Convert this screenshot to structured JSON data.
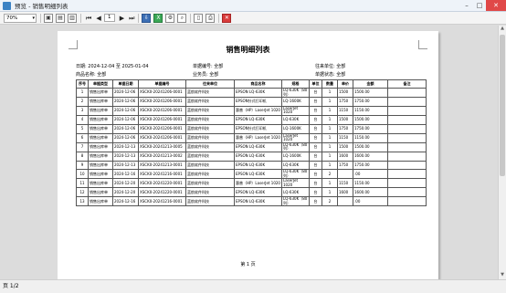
{
  "window": {
    "title": "预览 - 销售明细列表"
  },
  "toolbar": {
    "zoom": "70%",
    "page_input": "1"
  },
  "report": {
    "title": "销售明细列表",
    "date_range": "日期: 2024-12-04 至 2025-01-04",
    "doc_no": "单据编号: 全部",
    "contact": "往来单位: 全部",
    "product": "商品名称: 全部",
    "salesman": "业务员: 全部",
    "doc_status": "单据状态: 全部",
    "columns": [
      "序号",
      "单据类型",
      "单据日期",
      "单据编号",
      "往来单位",
      "商品名称",
      "规格",
      "单位",
      "数量",
      "单价",
      "金额",
      "备注"
    ],
    "rows": [
      [
        "1",
        "销售出库单",
        "2024-12-06",
        "XSCK0-20241206-0001",
        "蓝航软件科技",
        "EPSON LQ-630K",
        "LQ-630K（80列）",
        "台",
        "1",
        "1500",
        "1500.00",
        ""
      ],
      [
        "2",
        "销售出库单",
        "2024-12-06",
        "XSCK0-20241206-0001",
        "蓝航软件科技",
        "EPSON针式打印机",
        "LQ-1600K",
        "台",
        "1",
        "1750",
        "1750.00",
        ""
      ],
      [
        "3",
        "销售出库单",
        "2024-12-06",
        "XSCK0-20241206-0001",
        "蓝航软件科技",
        "惠普（HP）LaserJet 1020",
        "LaserJet 1020",
        "台",
        "1",
        "1150",
        "1150.00",
        ""
      ],
      [
        "4",
        "销售出库单",
        "2024-12-06",
        "XSCK0-20241206-0001",
        "蓝航软件科技",
        "EPSON LQ-630K",
        "LQ-630K",
        "台",
        "1",
        "1500",
        "1500.00",
        ""
      ],
      [
        "5",
        "销售出库单",
        "2024-12-06",
        "XSCK0-20241206-0001",
        "蓝航软件科技",
        "EPSON针式打印机",
        "LQ-1600K",
        "台",
        "1",
        "1750",
        "1750.00",
        ""
      ],
      [
        "6",
        "销售出库单",
        "2024-12-06",
        "XSCK0-20241206-0001",
        "蓝航软件科技",
        "惠普（HP）LaserJet 1020",
        "LaserJet 1020",
        "台",
        "1",
        "1150",
        "1150.00",
        ""
      ],
      [
        "7",
        "销售出库单",
        "2024-12-13",
        "XSCK0-20241213-0005",
        "蓝航软件科技",
        "EPSON LQ-630K",
        "LQ-630K（80列）",
        "台",
        "1",
        "1500",
        "1500.00",
        ""
      ],
      [
        "8",
        "销售出库单",
        "2024-12-13",
        "XSCK0-20241213-0002",
        "蓝航软件科技",
        "EPSON LQ-630K",
        "LQ-1600K",
        "台",
        "1",
        "1600",
        "1600.00",
        ""
      ],
      [
        "9",
        "销售出库单",
        "2024-12-13",
        "XSCK0-20241213-0001",
        "蓝航软件科技",
        "EPSON LQ-630K",
        "LQ-630K",
        "台",
        "1",
        "1750",
        "1750.00",
        ""
      ],
      [
        "10",
        "销售出库单",
        "2024-12-16",
        "XSCK0-20241216-0001",
        "蓝航软件科技",
        "EPSON LQ-630K",
        "LQ-630K（80列）",
        "台",
        "2",
        "",
        ".00",
        ""
      ],
      [
        "11",
        "销售出库单",
        "2024-12-20",
        "XSCK0-20241220-0001",
        "蓝航软件科技",
        "惠普（HP）LaserJet 1020",
        "LaserJet 1020",
        "台",
        "1",
        "1150",
        "1150.00",
        ""
      ],
      [
        "12",
        "销售出库单",
        "2024-12-20",
        "XSCK0-20241220-0001",
        "蓝航软件科技",
        "EPSON LQ-630K",
        "LQ-630K",
        "台",
        "1",
        "1600",
        "1600.00",
        ""
      ],
      [
        "13",
        "销售出库单",
        "2024-12-16",
        "XSCK0-20241216-0001",
        "蓝航软件科技",
        "EPSON LQ-630K",
        "LQ-630K（80列）",
        "台",
        "2",
        "",
        ".00",
        ""
      ]
    ],
    "footer": "第 1 页"
  },
  "status": {
    "page": "页 1/2"
  },
  "icons": [
    "app-icon",
    "save-icon",
    "print-icon",
    "export-icon",
    "first-page-icon",
    "prev-page-icon",
    "next-page-icon",
    "last-page-icon",
    "excel-icon",
    "close-icon"
  ]
}
